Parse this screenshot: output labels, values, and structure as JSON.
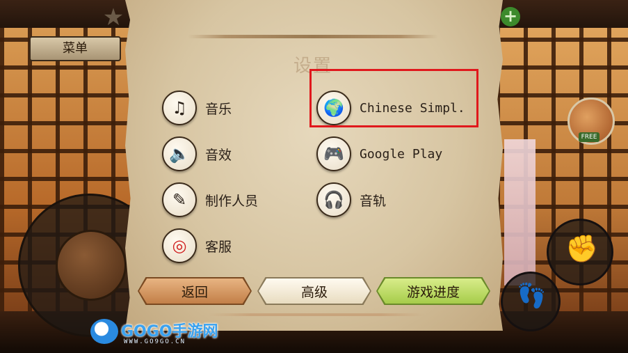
{
  "hud": {
    "menu_label": "菜单",
    "free_label": "FREE",
    "star_icon": "star-icon",
    "plus_icon": "plus-icon",
    "punch_icon": "fist-icon",
    "kick_icon": "foot-icon"
  },
  "settings": {
    "title": "设置",
    "options_left": [
      {
        "label": "音乐",
        "icon": "music-note-icon",
        "glyph": "♫"
      },
      {
        "label": "音效",
        "icon": "speaker-icon",
        "glyph": "🔈"
      },
      {
        "label": "制作人员",
        "icon": "paintbrush-icon",
        "glyph": "✎"
      },
      {
        "label": "客服",
        "icon": "lifebuoy-icon",
        "glyph": "◎"
      }
    ],
    "options_right": [
      {
        "label": "Chinese Simpl.",
        "icon": "globe-icon",
        "glyph": "🌍"
      },
      {
        "label": "Google Play",
        "icon": "gamepad-icon",
        "glyph": "🎮"
      },
      {
        "label": "音轨",
        "icon": "headphones-icon",
        "glyph": "🎧"
      }
    ],
    "buttons": {
      "back": "返回",
      "advanced": "高级",
      "progress": "游戏进度"
    }
  },
  "watermark": {
    "name": "GOGO手游网",
    "url": "WWW.GO9GO.CN"
  },
  "colors": {
    "highlight": "#e0181c",
    "back_button": "#c27f48",
    "progress_button": "#a6cc4a"
  }
}
